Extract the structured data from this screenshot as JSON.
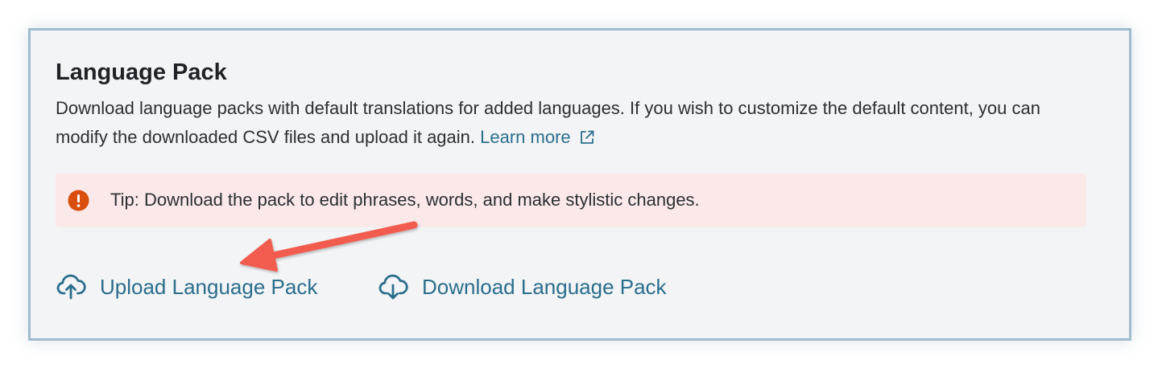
{
  "panel": {
    "title": "Language Pack",
    "description": "Download language packs with default translations for added languages. If you wish to customize the default content, you can modify the downloaded CSV files and upload it again.",
    "learn_more_label": "Learn more"
  },
  "tip": {
    "text": "Tip: Download the pack to edit phrases, words, and make stylistic changes."
  },
  "actions": {
    "upload_label": "Upload Language Pack",
    "download_label": "Download Language Pack"
  },
  "colors": {
    "accent": "#2a6e8c",
    "tip_background": "#fbe8e8",
    "warning_icon": "#d94e0c",
    "annotation_arrow": "#f25c4f",
    "frame_border": "#9fbccb"
  },
  "icons": {
    "learn_more": "external-link-icon",
    "tip": "warning-icon",
    "upload": "cloud-upload-icon",
    "download": "cloud-download-icon"
  }
}
